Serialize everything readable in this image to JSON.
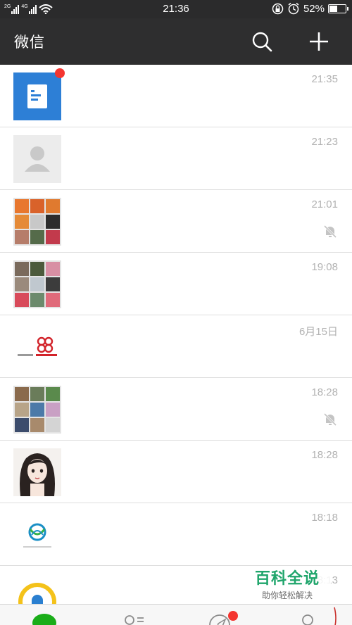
{
  "status_bar": {
    "network_sim1": "2G",
    "network_sim2": "4G",
    "time": "21:36",
    "battery_text": "52%",
    "battery_level": 0.52
  },
  "header": {
    "title": "微信",
    "icons": [
      "search-icon",
      "add-icon"
    ]
  },
  "chats": [
    {
      "time": "21:35",
      "avatar": "document-app-avatar",
      "unread_dot": true,
      "muted": false
    },
    {
      "time": "21:23",
      "avatar": "default-person-avatar",
      "unread_dot": false,
      "muted": false
    },
    {
      "time": "21:01",
      "avatar": "group-avatar",
      "unread_dot": false,
      "muted": true
    },
    {
      "time": "19:08",
      "avatar": "group-avatar",
      "unread_dot": false,
      "muted": false
    },
    {
      "time": "6月15日",
      "avatar": "china-unicom-logo",
      "unread_dot": false,
      "muted": false
    },
    {
      "time": "18:28",
      "avatar": "group-avatar",
      "unread_dot": false,
      "muted": true
    },
    {
      "time": "18:28",
      "avatar": "illustrated-girl-avatar",
      "unread_dot": false,
      "muted": false
    },
    {
      "time": "18:18",
      "avatar": "china-mobile-logo",
      "unread_dot": false,
      "muted": false
    },
    {
      "time": "18:13",
      "avatar": "qq-style-logo",
      "unread_dot": false,
      "muted": false
    }
  ],
  "tabs": {
    "icons": [
      "chats-tab-icon",
      "contacts-tab-icon",
      "discover-tab-icon",
      "me-tab-icon"
    ],
    "discover_has_dot": true
  },
  "watermark": {
    "title": "百科全说",
    "subtitle": "助你轻松解决"
  },
  "colors": {
    "title_bar": "#2e2e2f",
    "status_bar": "#2b2b2c",
    "badge_red": "#f43530",
    "wechat_green": "#1aad19",
    "time_gray": "#b2b2b2",
    "watermark_green": "#1fa56b"
  }
}
